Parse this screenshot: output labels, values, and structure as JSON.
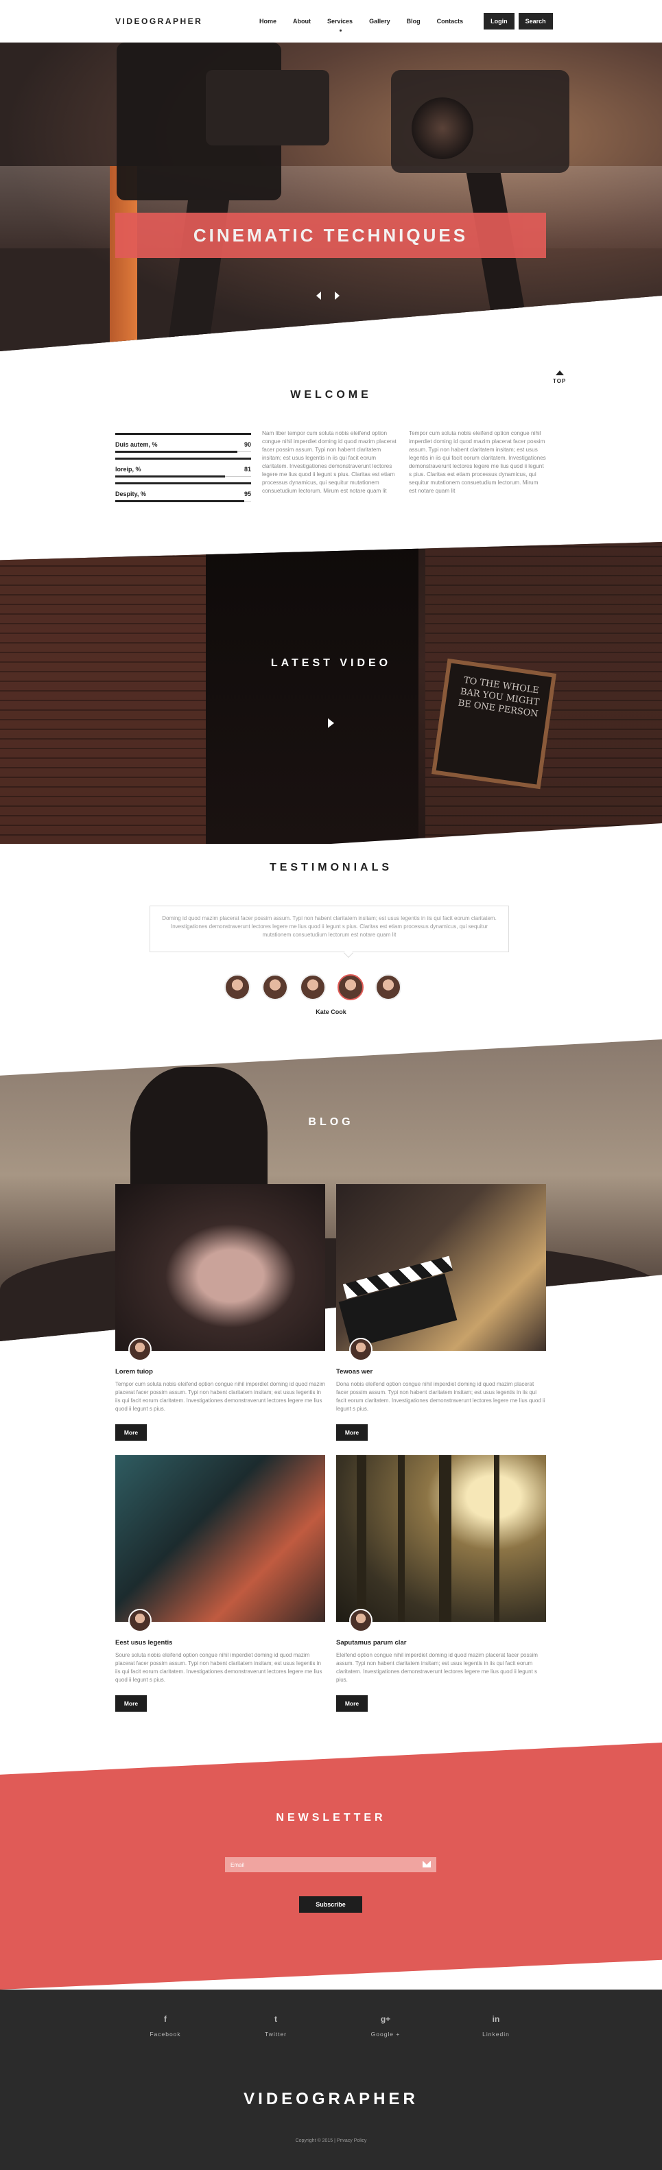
{
  "header": {
    "logo": "VIDEOGRAPHER",
    "nav": [
      "Home",
      "About",
      "Services",
      "Gallery",
      "Blog",
      "Contacts"
    ],
    "login_label": "Login",
    "search_label": "Search"
  },
  "hero": {
    "title": "CINEMATIC TECHNIQUES"
  },
  "welcome": {
    "title": "WELCOME",
    "top_label": "TOP",
    "stats": [
      {
        "label": "Duis autem, %",
        "value": "90",
        "fraction": 0.9
      },
      {
        "label": "loreip, %",
        "value": "81",
        "fraction": 0.81
      },
      {
        "label": "Despity, %",
        "value": "95",
        "fraction": 0.95
      }
    ],
    "col1": "Nam liber tempor cum soluta nobis eleifend option congue nihil imperdiet doming id quod mazim placerat facer possim assum. Typi non habent claritatem insitam; est usus legentis in iis qui facit eorum claritatem. Investigationes demonstraverunt lectores legere me lius quod ii legunt s pius. Claritas est etiam processus dynamicus, qui sequitur mutationem consuetudium lectorum. Mirum est notare quam lit",
    "col2": "Tempor cum soluta nobis eleifend option congue nihil imperdiet doming id quod mazim placerat facer possim assum. Typi non habent claritatem insitam; est usus legentis in iis qui facit eorum claritatem. Investigationes demonstraverunt lectores legere me lius quod ii legunt s pius. Claritas est etiam processus dynamicus, qui sequitur mutationem consuetudium lectorum. Mirum est notare quam lit"
  },
  "video": {
    "title": "LATEST VIDEO",
    "board_text": "TO THE WHOLE BAR YOU MIGHT BE ONE PERSON"
  },
  "testimonials": {
    "title": "TESTIMONIALS",
    "quote": "Doming id quod mazim placerat facer possim assum. Typi non habent claritatem insitam; est usus legentis in iis qui facit eorum claritatem. Investigationes demonstraverunt lectores legere me lius quod ii legunt s pius. Claritas est etiam processus dynamicus, qui sequitur mutationem consuetudium lectorum est notare quam lit",
    "name": "Kate Cook"
  },
  "blog": {
    "title": "BLOG",
    "more_label": "More",
    "posts": [
      {
        "title": "Lorem tuiop",
        "text": "Tempor cum soluta nobis eleifend option congue nihil imperdiet doming id quod mazim placerat facer possim assum. Typi non habent claritatem insitam; est usus legentis in iis qui facit eorum claritatem. Investigationes demonstraverunt lectores legere me lius quod ii legunt s pius."
      },
      {
        "title": "Tewoas wer",
        "text": "Dona nobis eleifend option congue nihil imperdiet doming id quod mazim placerat facer possim assum. Typi non habent claritatem insitam; est usus legentis in iis qui facit eorum claritatem. Investigationes demonstraverunt lectores legere me lius quod ii legunt s pius."
      },
      {
        "title": "Eest usus legentis",
        "text": "Soure soluta nobis eleifend option congue nihil imperdiet doming id quod mazim placerat facer possim assum. Typi non habent claritatem insitam; est usus legentis in iis qui facit eorum claritatem. Investigationes demonstraverunt lectores legere me lius quod ii legunt s pius."
      },
      {
        "title": "Saputamus parum clar",
        "text": "Eleifend option congue nihil imperdiet doming id quod mazim placerat facer possim assum. Typi non habent claritatem insitam; est usus legentis in iis qui facit eorum claritatem. Investigationes demonstraverunt lectores legere me lius quod ii legunt s pius."
      }
    ]
  },
  "newsletter": {
    "title": "NEWSLETTER",
    "email_placeholder": "Email",
    "subscribe_label": "Subscribe"
  },
  "footer": {
    "social": [
      {
        "icon": "f",
        "name": "Facebook"
      },
      {
        "icon": "t",
        "name": "Twitter"
      },
      {
        "icon": "g+",
        "name": "Google +"
      },
      {
        "icon": "in",
        "name": "Linkedin"
      }
    ],
    "logo": "VIDEOGRAPHER",
    "copyright": "Copyright © 2015 | Privacy Policy"
  },
  "colors": {
    "accent": "#e05b57",
    "dark": "#2b2b2b"
  }
}
